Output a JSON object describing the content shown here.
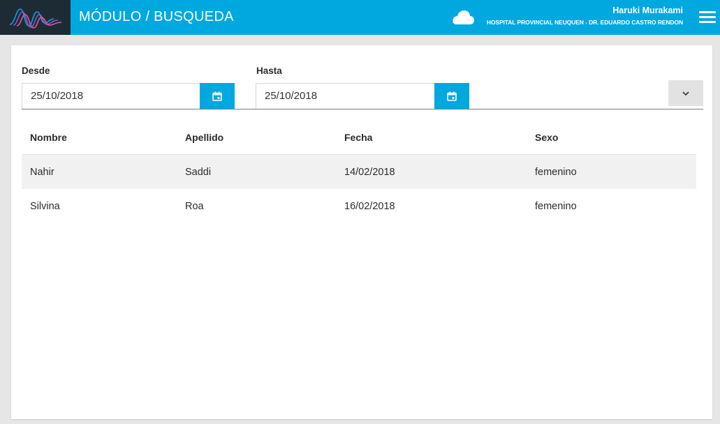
{
  "header": {
    "title": "MÓDULO / BUSQUEDA",
    "user_name": "Haruki Murakami",
    "organization": "HOSPITAL PROVINCIAL NEUQUEN - DR. EDUARDO CASTRO RENDON"
  },
  "filters": {
    "desde": {
      "label": "Desde",
      "value": "25/10/2018"
    },
    "hasta": {
      "label": "Hasta",
      "value": "25/10/2018"
    }
  },
  "table": {
    "columns": [
      "Nombre",
      "Apellido",
      "Fecha",
      "Sexo"
    ],
    "rows": [
      [
        "Nahir",
        "Saddi",
        "14/02/2018",
        "femenino"
      ],
      [
        "Silvina",
        "Roa",
        "16/02/2018",
        "femenino"
      ]
    ]
  },
  "colors": {
    "primary": "#00a8e0",
    "logo_bg": "#1d2b35",
    "page_bg": "#e6e6e6"
  },
  "icons": {
    "logo": "app-logo-icon",
    "cloud": "cloud-icon",
    "menu": "hamburger-menu-icon",
    "calendar": "calendar-icon",
    "chevron": "chevron-down-icon"
  }
}
